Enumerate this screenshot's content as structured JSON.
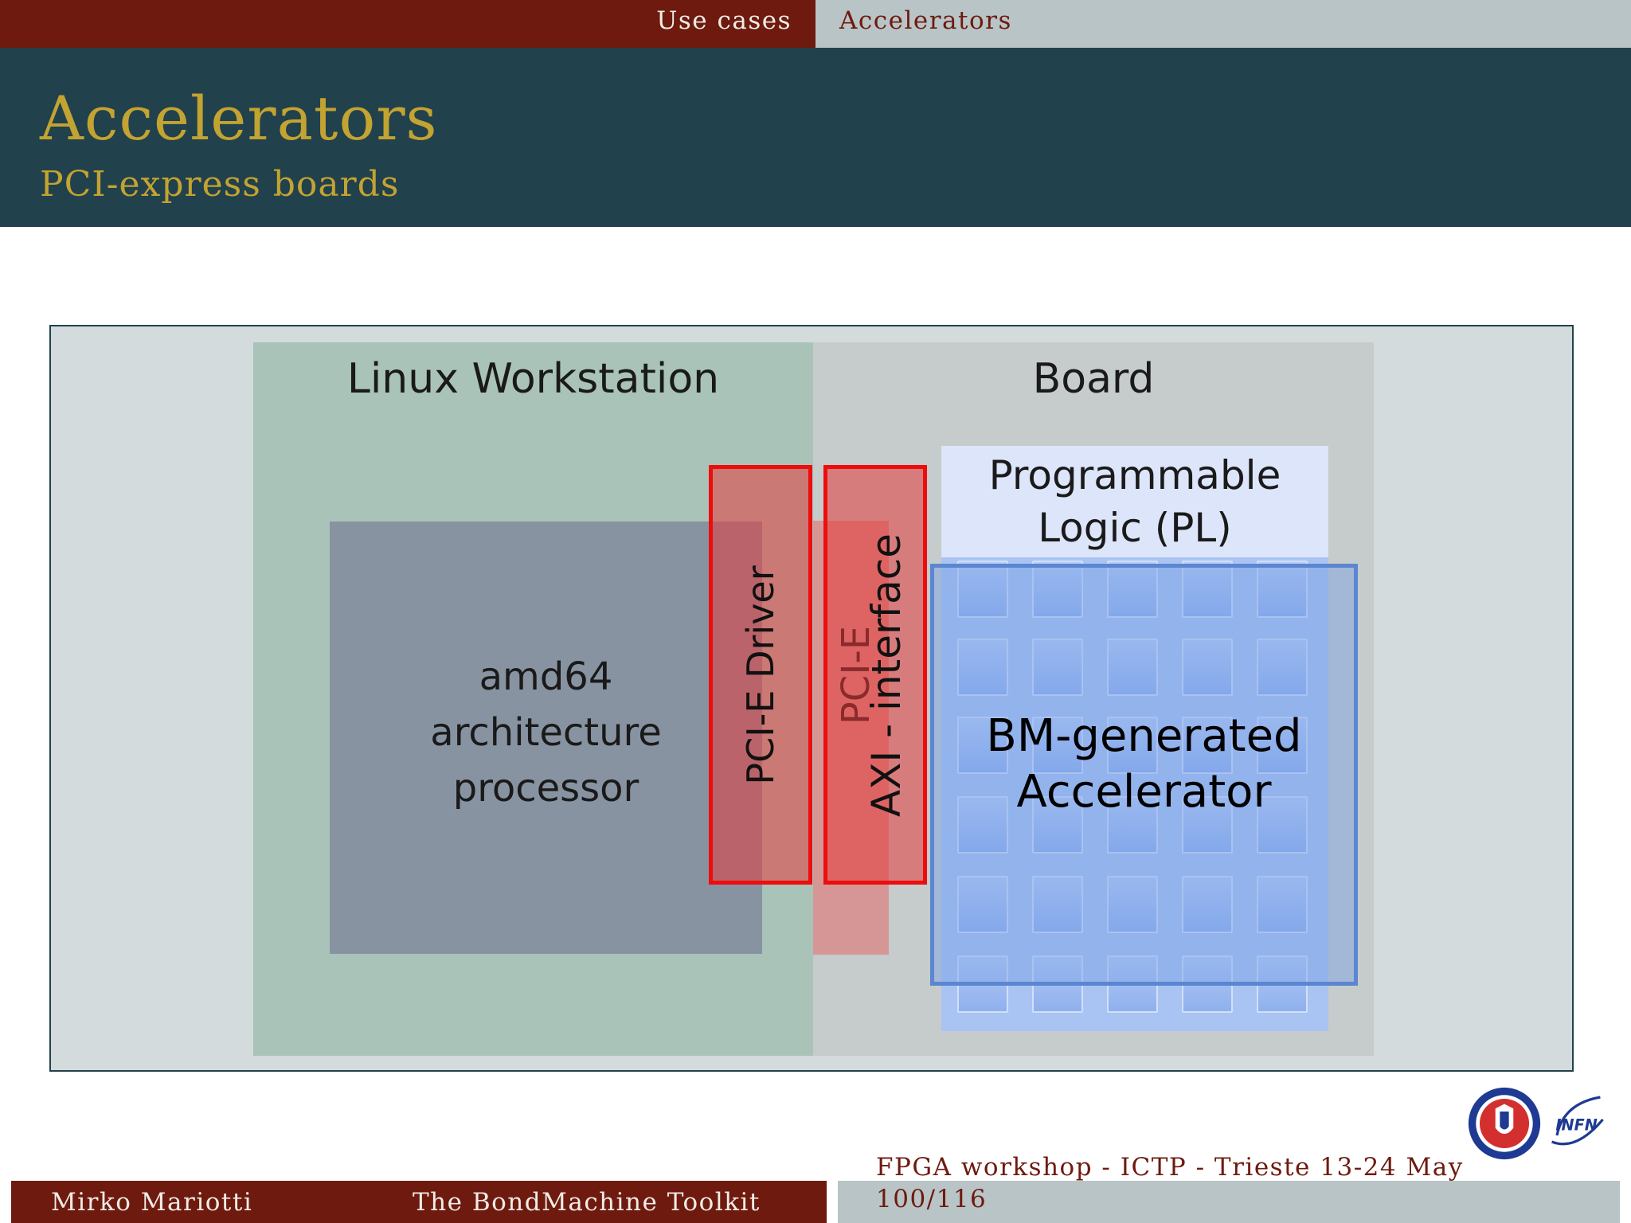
{
  "nav": {
    "section": "Use cases",
    "subsection": "Accelerators"
  },
  "slide": {
    "title": "Accelerators",
    "subtitle": "PCI-express boards"
  },
  "diagram": {
    "workstation_label": "Linux Workstation",
    "board_label": "Board",
    "cpu_lines": [
      "amd64",
      "architecture",
      "processor"
    ],
    "pl_lines": [
      "Programmable",
      "Logic (PL)"
    ],
    "pcie_driver_label": "PCI-E Driver",
    "pcie_faded_label": "PCI-E",
    "axi_label": "AXI - interface",
    "accelerator_lines": [
      "BM-generated",
      "Accelerator"
    ]
  },
  "footer": {
    "author": "Mirko Mariotti",
    "talk": "The BondMachine Toolkit",
    "event": "FPGA workshop - ICTP - Trieste 13-24 May",
    "page": "100/116"
  },
  "logos": {
    "university": "university-of-perugia-seal",
    "infn": "INFN"
  },
  "colors": {
    "header_red": "#6e1a0f",
    "header_grey": "#b8c4c6",
    "title_band": "#21414c",
    "title_gold": "#c3a331",
    "pcie_red": "#ee0d0d",
    "accelerator_blue": "#5b86d0"
  }
}
